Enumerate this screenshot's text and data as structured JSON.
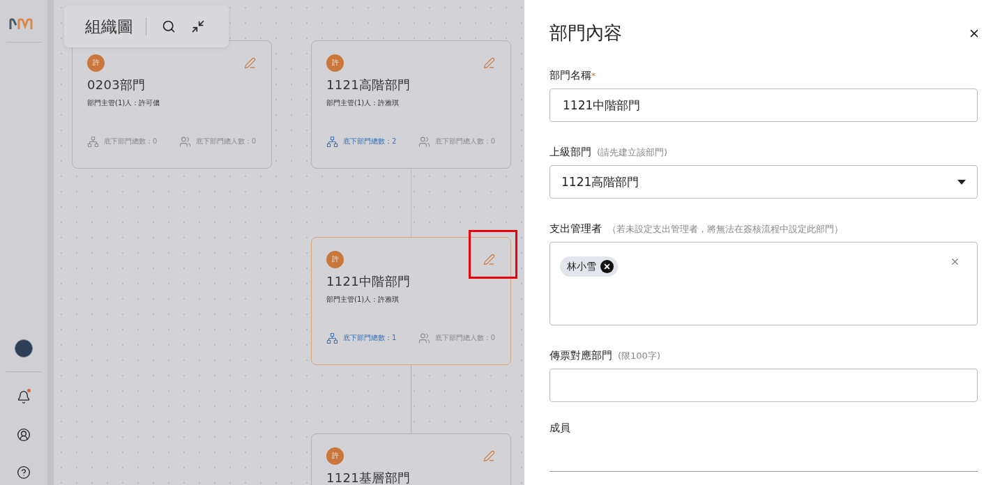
{
  "sidebar": {
    "nav": [
      {
        "kind": "notifications",
        "unread": true
      },
      {
        "kind": "profile",
        "unread": false
      },
      {
        "kind": "help",
        "unread": false
      }
    ]
  },
  "toolbar": {
    "title": "組織圖"
  },
  "org_chart": {
    "nodes": [
      {
        "avatar": "許",
        "name": "0203部門",
        "manager": "部門主管(1)人：許可儂",
        "sub_count": "底下部門總數：0",
        "sub_active": false,
        "member_count": "底下部門總人數：0",
        "selected": false,
        "edit_highlighted": false
      },
      {
        "avatar": "許",
        "name": "1121高階部門",
        "manager": "部門主管(1)人：許雅琪",
        "sub_count": "底下部門總數：2",
        "sub_active": true,
        "member_count": "底下部門總人數：0",
        "selected": false,
        "edit_highlighted": false,
        "children": [
          {
            "avatar": "許",
            "name": "1121中階部門",
            "manager": "部門主管(1)人：許雅琪",
            "sub_count": "底下部門總數：1",
            "sub_active": true,
            "member_count": "底下部門總人數：0",
            "selected": true,
            "edit_highlighted": true,
            "children": [
              {
                "avatar": "許",
                "name": "1121基層部門",
                "selected": false,
                "edit_highlighted": false
              }
            ]
          }
        ]
      }
    ]
  },
  "drawer": {
    "title": "部門內容",
    "fields": [
      {
        "kind": "text",
        "label": "部門名稱",
        "required_mark": "*",
        "value": "1121中階部門"
      },
      {
        "kind": "select",
        "label": "上級部門",
        "hint": "(請先建立該部門)",
        "value": "1121高階部門"
      },
      {
        "kind": "tags",
        "label": "支出管理者",
        "hint": "（若未設定支出管理者，將無法在簽核流程中設定此部門）",
        "tags": [
          "林小雪"
        ]
      },
      {
        "kind": "text",
        "label": "傳票對應部門",
        "hint": "(限100字)"
      },
      {
        "kind": "section",
        "label": "成員"
      }
    ]
  }
}
